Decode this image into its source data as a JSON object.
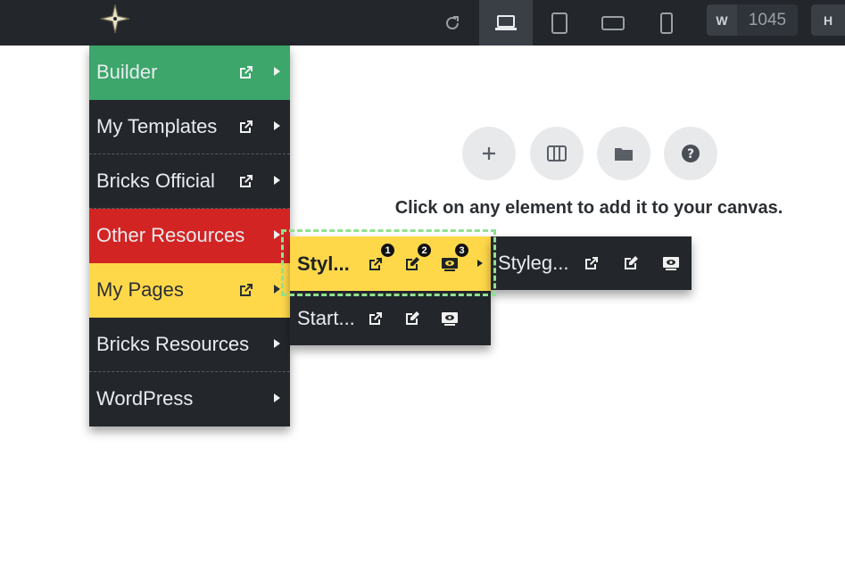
{
  "topbar": {
    "width_label": "W",
    "width_value": "1045",
    "height_label": "H"
  },
  "canvas": {
    "message": "Click on any element to add it to your canvas."
  },
  "menu": {
    "items": [
      {
        "label": "Builder"
      },
      {
        "label": "My Templates"
      },
      {
        "label": "Bricks Official"
      },
      {
        "label": "Other Resources"
      },
      {
        "label": "My Pages"
      },
      {
        "label": "Bricks Resources"
      },
      {
        "label": "WordPress"
      }
    ]
  },
  "submenu": {
    "items": [
      {
        "label": "Styl..."
      },
      {
        "label": "Start..."
      }
    ],
    "badges": [
      "1",
      "2",
      "3"
    ]
  },
  "submenu2": {
    "items": [
      {
        "label": "Styleg..."
      }
    ]
  },
  "colors": {
    "dark": "#23272c",
    "green": "#3ca66b",
    "red": "#d32424",
    "yellow": "#ffd84a",
    "highlight": "#8fe28f"
  }
}
